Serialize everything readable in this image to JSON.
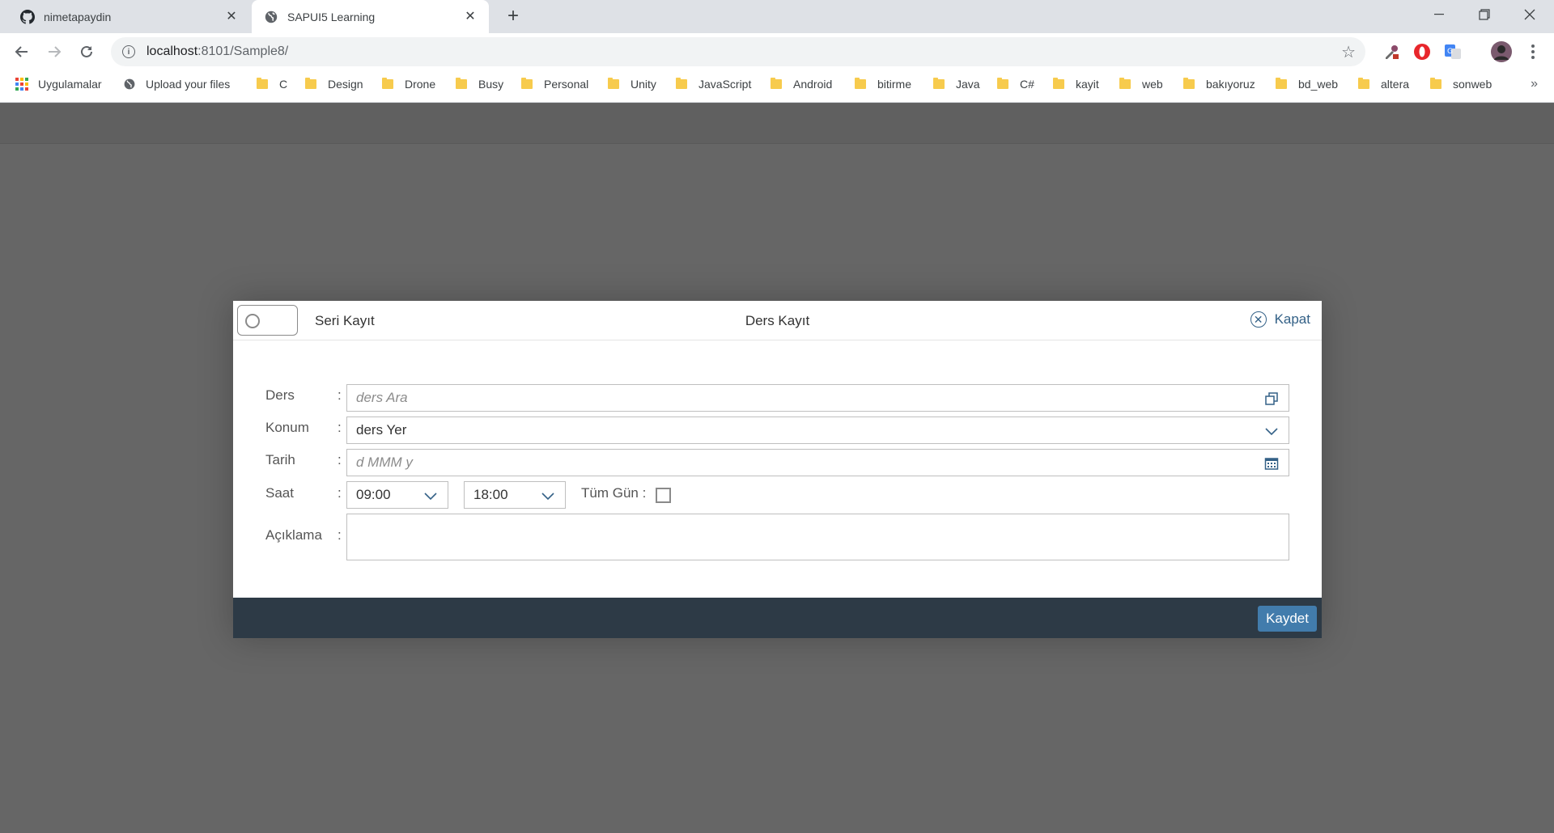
{
  "browser": {
    "tabs": [
      {
        "title": "nimetapaydin",
        "icon": "github-icon",
        "active": false
      },
      {
        "title": "SAPUI5 Learning",
        "icon": "globe-icon",
        "active": true
      }
    ],
    "address": {
      "host": "localhost",
      "path": ":8101/Sample8/"
    },
    "bookmarks": {
      "apps_label": "Uygulamalar",
      "upload_label": "Upload your files",
      "folders": [
        "C",
        "Design",
        "Drone",
        "Busy",
        "Personal",
        "Unity",
        "JavaScript",
        "Android",
        "bitirme",
        "Java",
        "C#",
        "kayit",
        "web",
        "bakıyoruz",
        "bd_web",
        "altera",
        "sonweb"
      ],
      "more": "»"
    }
  },
  "dialog": {
    "toggle_label": "Seri Kayıt",
    "title": "Ders Kayıt",
    "close_label": "Kapat",
    "colon": ":",
    "fields": {
      "ders": {
        "label": "Ders",
        "placeholder": "ders Ara"
      },
      "konum": {
        "label": "Konum",
        "value": "ders Yer"
      },
      "tarih": {
        "label": "Tarih",
        "placeholder": "d MMM y"
      },
      "saat": {
        "label": "Saat",
        "start": "09:00",
        "end": "18:00",
        "allday_label": "Tüm Gün :"
      },
      "aciklama": {
        "label": "Açıklama",
        "value": ""
      }
    },
    "save_label": "Kaydet"
  },
  "colors": {
    "accent": "#427cac",
    "link": "#346187",
    "footer": "#2d3a46",
    "backdrop": "#666666"
  }
}
